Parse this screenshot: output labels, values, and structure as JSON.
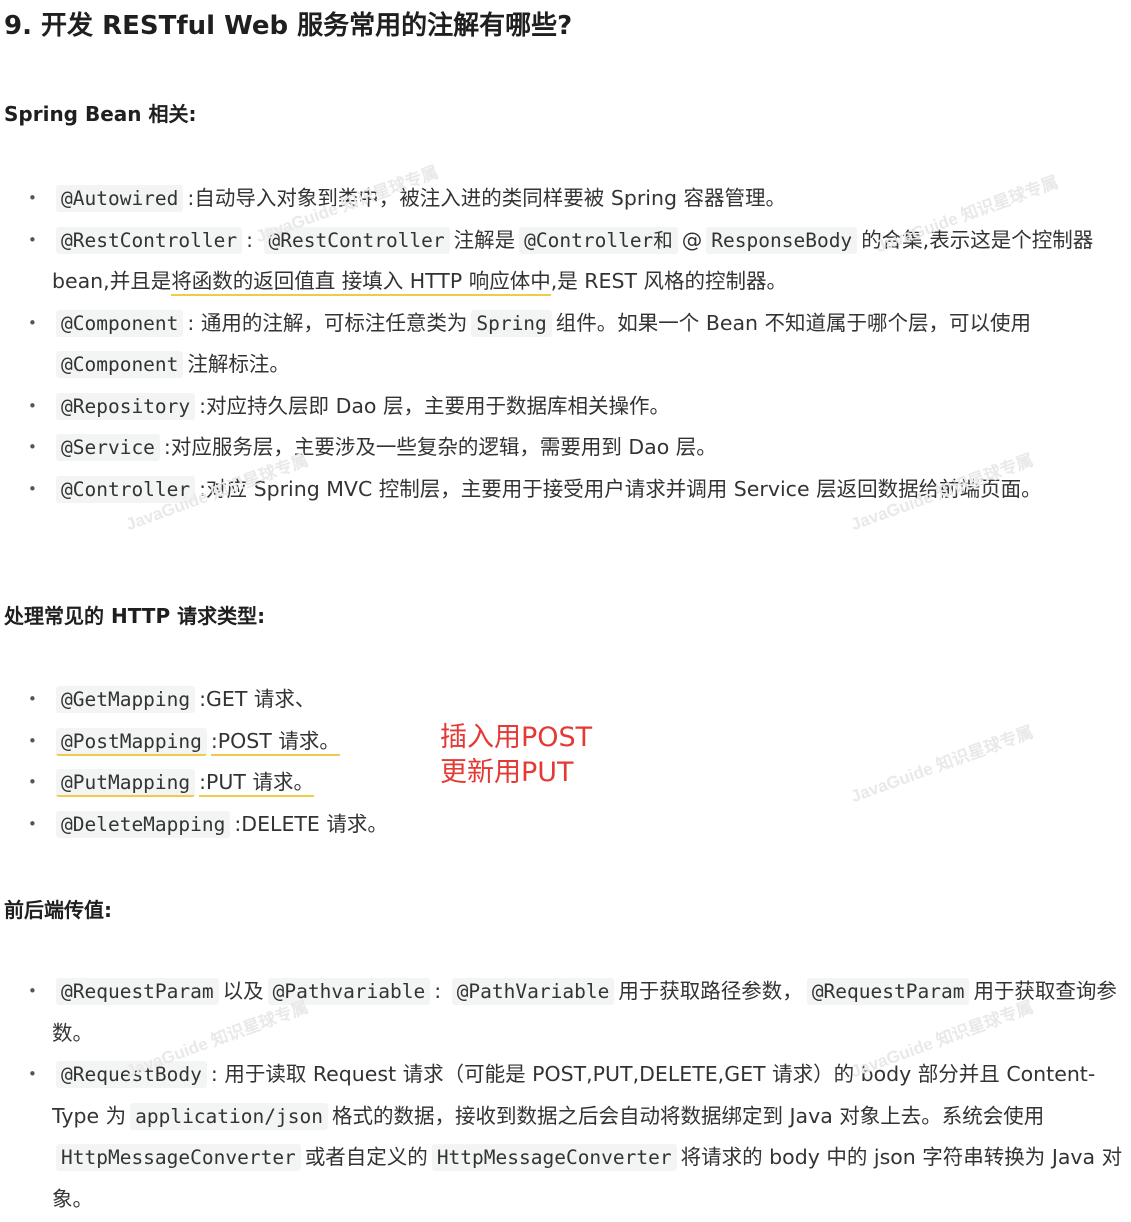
{
  "title": "9. 开发 RESTful Web 服务常用的注解有哪些?",
  "sections": {
    "bean": {
      "heading": "Spring Bean 相关:",
      "items": [
        {
          "code": "@Autowired",
          "text": ":自动导入对象到类中，被注入进的类同样要被 Spring 容器管理。"
        },
        {
          "code": "@RestController",
          "text1": ": ",
          "code2": "@RestController",
          "text2": "注解是",
          "code3": "@Controller和",
          "text3": "@",
          "code4": "ResponseBody",
          "text4": "的合集,表示这是个控制器 bean,并且是",
          "highlight": "将函数的返回值直 接填入 HTTP 响应体中",
          "text5": ",是 REST 风格的控制器。"
        },
        {
          "code": "@Component",
          "text1": ": 通用的注解，可标注任意类为",
          "code2": "Spring",
          "text2": "组件。如果一个 Bean 不知道属于哪个层，可以使用",
          "code3": "@Component",
          "text3": "注解标注。"
        },
        {
          "code": "@Repository",
          "text": ":对应持久层即 Dao 层，主要用于数据库相关操作。"
        },
        {
          "code": "@Service",
          "text": ":对应服务层，主要涉及一些复杂的逻辑，需要用到 Dao 层。"
        },
        {
          "code": "@Controller",
          "text": ":对应 Spring MVC 控制层，主要用于接受用户请求并调用 Service 层返回数据给前端页面。"
        }
      ]
    },
    "http": {
      "heading": "处理常见的 HTTP 请求类型:",
      "items": [
        {
          "code": "@GetMapping",
          "text": ":GET 请求、"
        },
        {
          "code": "@PostMapping",
          "text": ":POST 请求。"
        },
        {
          "code": "@PutMapping",
          "text": ":PUT 请求。"
        },
        {
          "code": "@DeleteMapping",
          "text": ":DELETE 请求。"
        }
      ]
    },
    "params": {
      "heading": "前后端传值:",
      "items": [
        {
          "code": "@RequestParam",
          "text1": "以及",
          "code2": "@Pathvariable",
          "text2": ": ",
          "code3": "@PathVariable",
          "text3": "用于获取路径参数，",
          "code4": "@RequestParam",
          "text4": "用于获取查询参数。"
        },
        {
          "code": "@RequestBody",
          "text1": ": 用于读取 Request 请求（可能是 POST,PUT,DELETE,GET 请求）的 body 部分并且 Content-Type 为",
          "code2": "application/json",
          "text2": "格式的数据，接收到数据之后会自动将数据绑定到 Java 对象上去。系统会使用",
          "code3": "HttpMessageConverter",
          "text3": "或者自定义的",
          "code4": "HttpMessageConverter",
          "text4": "将请求的 body 中的 json 字符串转换为 Java 对象。"
        }
      ]
    }
  },
  "annotation": {
    "line1": "插入用POST",
    "line2": "更新用PUT",
    "color": "#e53935"
  },
  "watermark": {
    "text": "JavaGuide 知识星球专属"
  }
}
